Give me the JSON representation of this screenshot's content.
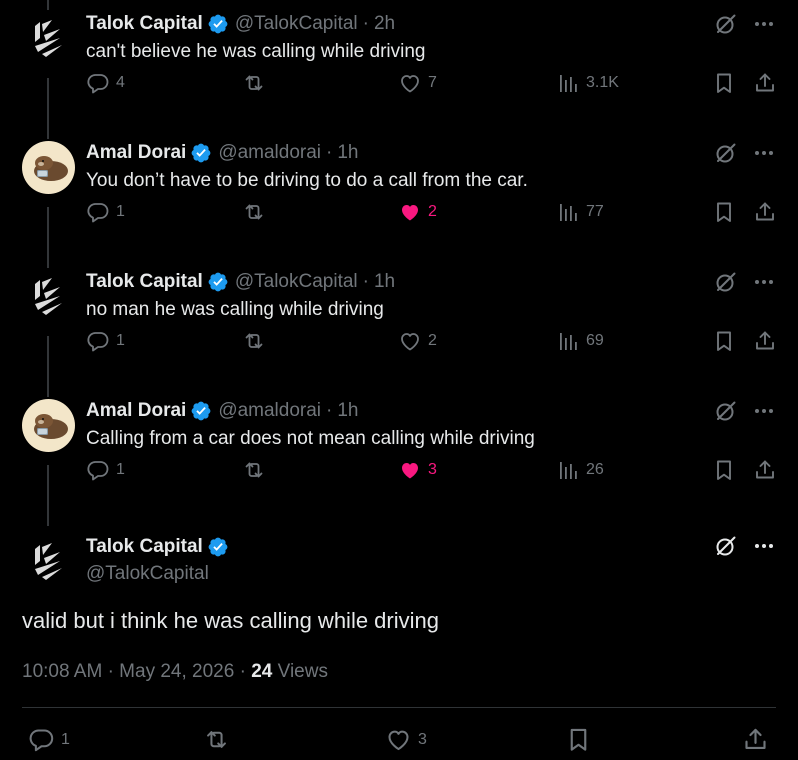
{
  "colors": {
    "background": "#000000",
    "text": "#e7e9ea",
    "muted": "#71767b",
    "verified": "#1d9bf0",
    "like": "#f91880"
  },
  "replies": [
    {
      "author": "Talok Capital",
      "handle": "@TalokCapital",
      "time": "2h",
      "text": "can't believe he was calling while driving",
      "avatar": "talok-logo",
      "reply_count": "4",
      "like_count": "7",
      "liked": false,
      "views": "3.1K"
    },
    {
      "author": "Amal Dorai",
      "handle": "@amaldorai",
      "time": "1h",
      "text": "You don’t have to be driving to do a call from the car.",
      "avatar": "otter-photo",
      "reply_count": "1",
      "like_count": "2",
      "liked": true,
      "views": "77"
    },
    {
      "author": "Talok Capital",
      "handle": "@TalokCapital",
      "time": "1h",
      "text": "no man he was calling while driving",
      "avatar": "talok-logo",
      "reply_count": "1",
      "like_count": "2",
      "liked": false,
      "views": "69"
    },
    {
      "author": "Amal Dorai",
      "handle": "@amaldorai",
      "time": "1h",
      "text": "Calling from a car does not mean calling while driving",
      "avatar": "otter-photo",
      "reply_count": "1",
      "like_count": "3",
      "liked": true,
      "views": "26"
    }
  ],
  "main": {
    "author": "Talok Capital",
    "handle": "@TalokCapital",
    "text": "valid but i think he was calling while driving",
    "time": "10:08 AM",
    "date": "May 24, 2026",
    "views_count": "24",
    "views_label": "Views",
    "reply_count": "1",
    "like_count": "3"
  }
}
